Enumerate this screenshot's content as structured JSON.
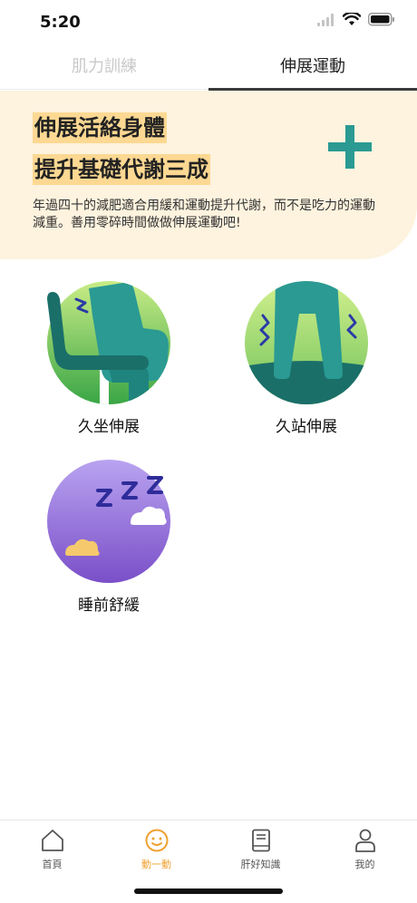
{
  "status": {
    "time": "5:20"
  },
  "tabs": [
    {
      "label": "肌力訓練",
      "active": false
    },
    {
      "label": "伸展運動",
      "active": true
    }
  ],
  "banner": {
    "line1": "伸展活絡身體",
    "line2": "提升基礎代謝三成",
    "description": "年過四十的減肥適合用緩和運動提升代謝，而不是吃力的運動減重。善用零碎時間做做伸展運動吧!",
    "accent_color": "#2a9a93",
    "highlight_color": "#fcd892",
    "background_color": "#fdf3de"
  },
  "cards": [
    {
      "label": "久坐伸展",
      "icon": "chair-legs-icon"
    },
    {
      "label": "久站伸展",
      "icon": "standing-legs-icon"
    },
    {
      "label": "睡前舒緩",
      "icon": "moon-sleep-icon"
    }
  ],
  "tabbar": {
    "items": [
      {
        "label": "首頁",
        "icon": "home-icon",
        "active": false
      },
      {
        "label": "動一動",
        "icon": "smile-icon",
        "active": true
      },
      {
        "label": "肝好知識",
        "icon": "book-icon",
        "active": false
      },
      {
        "label": "我的",
        "icon": "person-icon",
        "active": false
      }
    ],
    "active_color": "#f0a12f"
  }
}
